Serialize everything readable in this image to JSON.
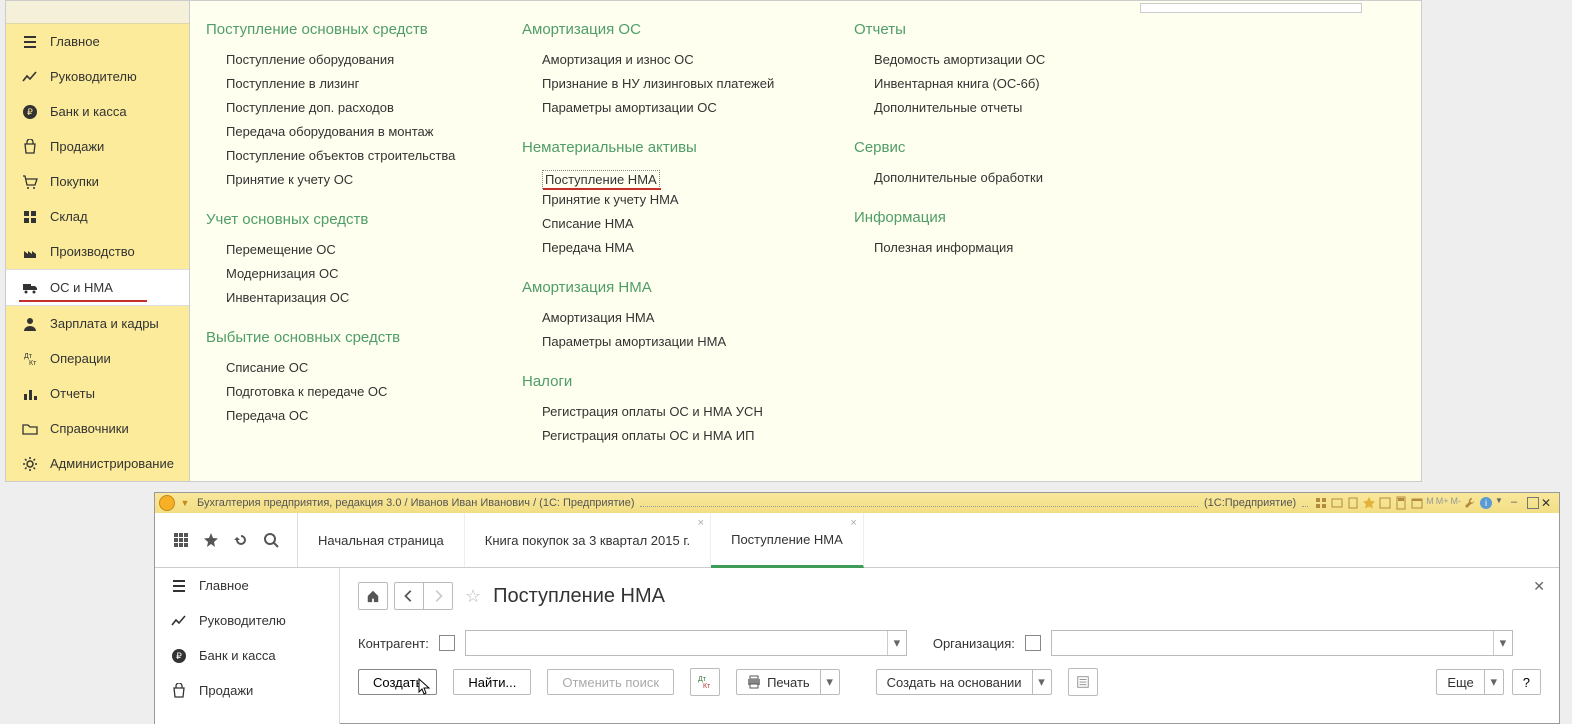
{
  "nav": {
    "main": "Главное",
    "manager": "Руководителю",
    "bank": "Банк и касса",
    "sales": "Продажи",
    "purchases": "Покупки",
    "warehouse": "Склад",
    "production": "Производство",
    "os_nma": "ОС и НМА",
    "salary": "Зарплата и кадры",
    "operations": "Операции",
    "reports": "Отчеты",
    "directories": "Справочники",
    "admin": "Администрирование"
  },
  "groups": {
    "g1": "Поступление основных средств",
    "g1_items": [
      "Поступление оборудования",
      "Поступление в лизинг",
      "Поступление доп. расходов",
      "Передача оборудования в монтаж",
      "Поступление объектов строительства",
      "Принятие к учету ОС"
    ],
    "g2": "Учет основных средств",
    "g2_items": [
      "Перемещение ОС",
      "Модернизация ОС",
      "Инвентаризация ОС"
    ],
    "g3": "Выбытие основных средств",
    "g3_items": [
      "Списание ОС",
      "Подготовка к передаче ОС",
      "Передача ОС"
    ],
    "g4": "Амортизация ОС",
    "g4_items": [
      "Амортизация и износ ОС",
      "Признание в НУ лизинговых платежей",
      "Параметры амортизации ОС"
    ],
    "g5": "Нематериальные активы",
    "g5_items": [
      "Поступление НМА",
      "Принятие к учету НМА",
      "Списание НМА",
      "Передача НМА"
    ],
    "g6": "Амортизация НМА",
    "g6_items": [
      "Амортизация НМА",
      "Параметры амортизации НМА"
    ],
    "g7": "Налоги",
    "g7_items": [
      "Регистрация оплаты ОС и НМА УСН",
      "Регистрация оплаты ОС и НМА ИП"
    ],
    "g8": "Отчеты",
    "g8_items": [
      "Ведомость амортизации ОС",
      "Инвентарная книга (ОС-6б)",
      "Дополнительные отчеты"
    ],
    "g9": "Сервис",
    "g9_items": [
      "Дополнительные обработки"
    ],
    "g10": "Информация",
    "g10_items": [
      "Полезная информация"
    ]
  },
  "w2": {
    "titlebar": "Бухгалтерия предприятия, редакция 3.0 / Иванов Иван Иванович / (1С: Предприятие)",
    "titlebar_app": "(1С:Предприятие)",
    "tabs": {
      "start": "Начальная страница",
      "t1": "Книга покупок за 3 квартал 2015 г.",
      "t2": "Поступление НМА"
    },
    "nav2": {
      "main": "Главное",
      "manager": "Руководителю",
      "bank": "Банк и касса",
      "sales": "Продажи"
    },
    "page": {
      "title": "Поступление НМА",
      "counterparty_label": "Контрагент:",
      "organization_label": "Организация:",
      "create": "Создать",
      "find": "Найти...",
      "cancel_search": "Отменить поиск",
      "print": "Печать",
      "create_based": "Создать на основании",
      "more": "Еще",
      "help": "?"
    }
  }
}
